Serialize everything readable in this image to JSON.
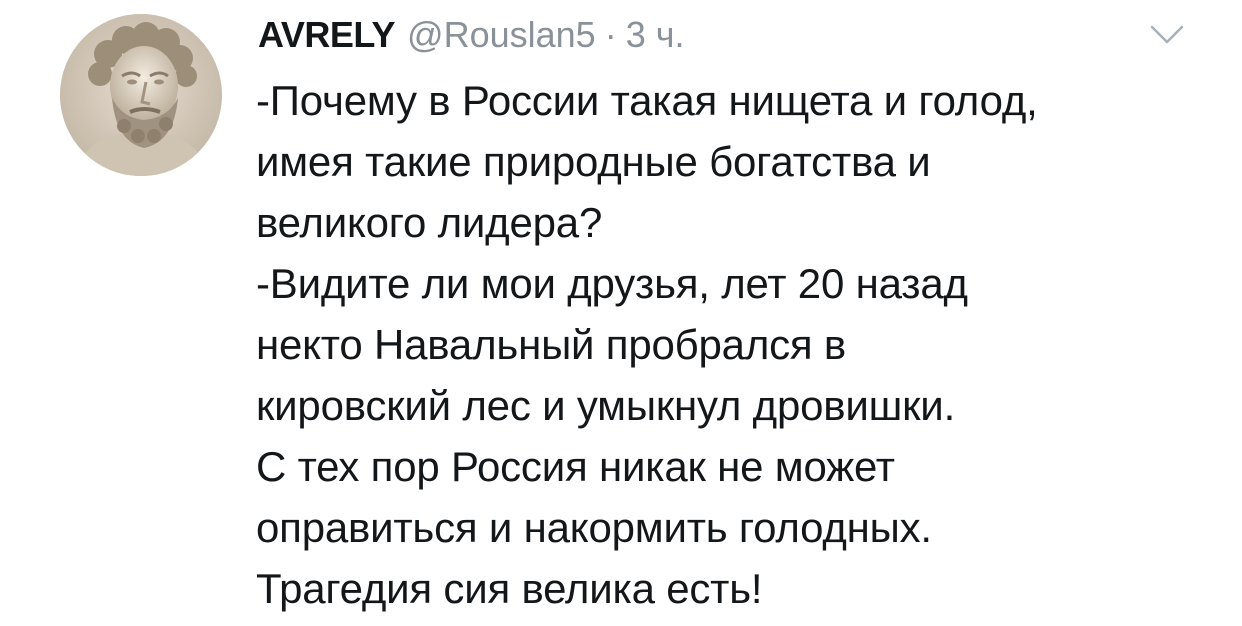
{
  "tweet": {
    "display_name": "AVRELY",
    "handle": "@Rouslan5",
    "separator": "·",
    "time": "3 ч.",
    "menu_icon": "chevron-down-icon",
    "avatar_icon": "marble-bust-avatar",
    "lines": [
      "-Почему в России такая нищета и голод,",
      "имея такие природные богатства и",
      "великого лидера?",
      "-Видите ли мои друзья, лет 20 назад",
      "некто Навальный пробрался в",
      "кировский лес и умыкнул дровишки.",
      "С тех пор Россия никак не может",
      "оправиться и накормить голодных.",
      "Трагедия сия велика есть!"
    ]
  }
}
